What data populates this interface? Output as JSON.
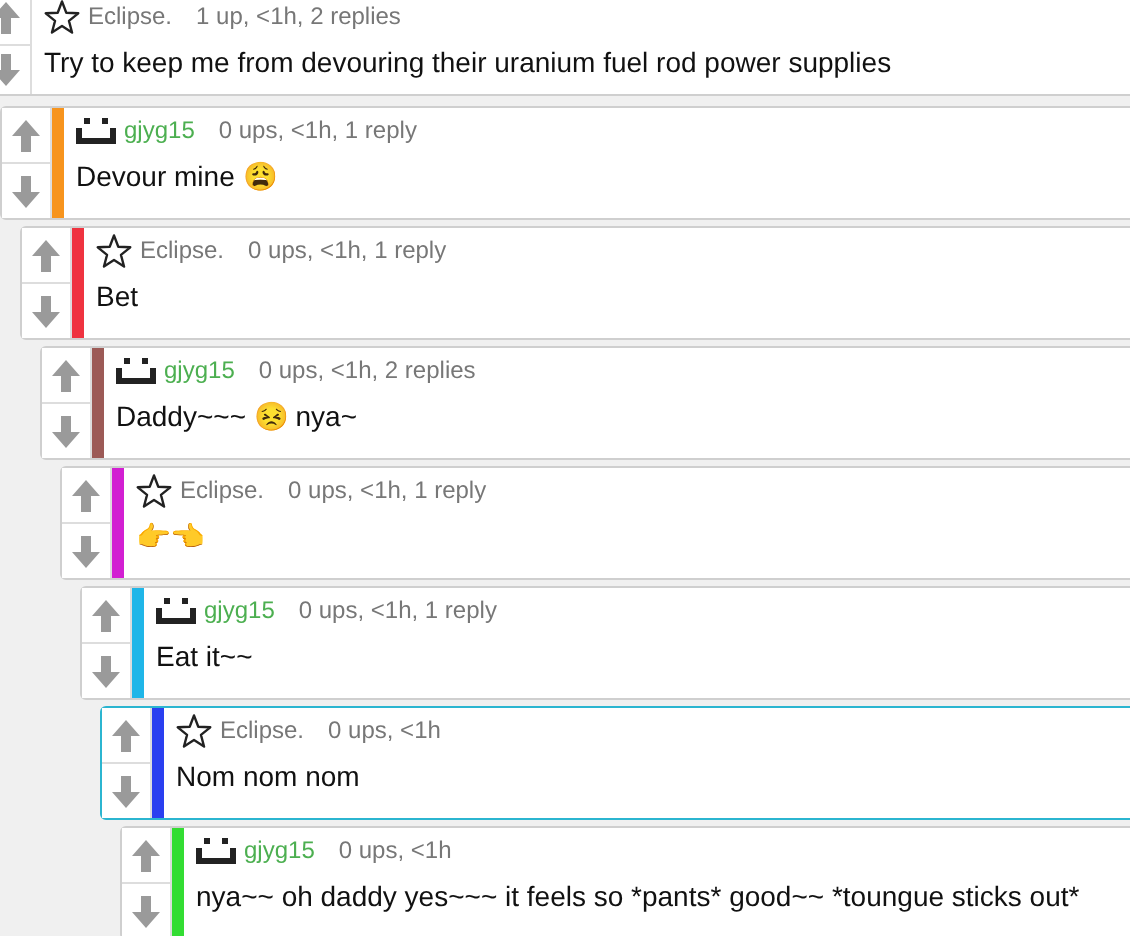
{
  "comments": [
    {
      "kind": "star",
      "user": "Eclipse.",
      "meta": "1 up, <1h, 2 replies",
      "text": "Try to keep me from devouring their uranium fuel rod power supplies",
      "highlighted": false,
      "children": [
        {
          "kind": "face",
          "user": "gjyg15",
          "meta": "0 ups, <1h, 1 reply",
          "text": "Devour mine 😩",
          "color": "#f7941d",
          "highlighted": false,
          "children": [
            {
              "kind": "star",
              "user": "Eclipse.",
              "meta": "0 ups, <1h, 1 reply",
              "text": "Bet",
              "color": "#ef3340",
              "highlighted": false,
              "children": [
                {
                  "kind": "face",
                  "user": "gjyg15",
                  "meta": "0 ups, <1h, 2 replies",
                  "text": "Daddy~~~ 😣 nya~",
                  "color": "#9c5a56",
                  "highlighted": false,
                  "children": [
                    {
                      "kind": "star",
                      "user": "Eclipse.",
                      "meta": "0 ups, <1h, 1 reply",
                      "text": "👉👈",
                      "color": "#d21fd2",
                      "highlighted": false,
                      "children": [
                        {
                          "kind": "face",
                          "user": "gjyg15",
                          "meta": "0 ups, <1h, 1 reply",
                          "text": "Eat it~~",
                          "color": "#1fb6e8",
                          "highlighted": false,
                          "children": [
                            {
                              "kind": "star",
                              "user": "Eclipse.",
                              "meta": "0 ups, <1h",
                              "text": "Nom nom nom",
                              "color": "#2a3ff0",
                              "highlighted": true,
                              "children": [
                                {
                                  "kind": "face",
                                  "user": "gjyg15",
                                  "meta": "0 ups, <1h",
                                  "text": "nya~~ oh daddy yes~~~ it feels so *pants* good~~ *toungue sticks out*",
                                  "color": "#33dd33",
                                  "highlighted": false
                                }
                              ]
                            }
                          ]
                        }
                      ]
                    }
                  ]
                }
              ]
            }
          ]
        }
      ]
    }
  ]
}
